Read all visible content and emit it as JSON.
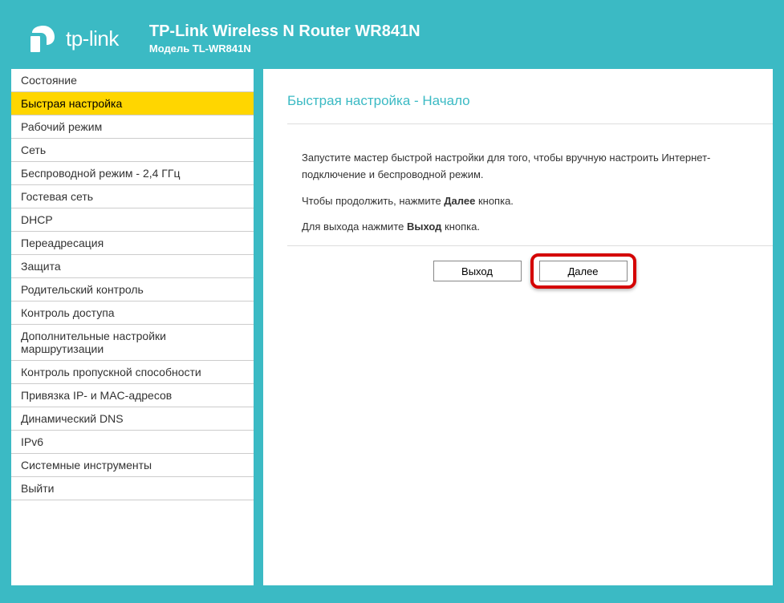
{
  "header": {
    "logo_text": "tp-link",
    "title": "TP-Link Wireless N Router WR841N",
    "subtitle": "Модель TL-WR841N"
  },
  "sidebar": {
    "items": [
      {
        "label": "Состояние",
        "active": false
      },
      {
        "label": "Быстрая настройка",
        "active": true
      },
      {
        "label": "Рабочий режим",
        "active": false
      },
      {
        "label": "Сеть",
        "active": false
      },
      {
        "label": "Беспроводной режим - 2,4 ГГц",
        "active": false
      },
      {
        "label": "Гостевая сеть",
        "active": false
      },
      {
        "label": "DHCP",
        "active": false
      },
      {
        "label": "Переадресация",
        "active": false
      },
      {
        "label": "Защита",
        "active": false
      },
      {
        "label": "Родительский контроль",
        "active": false
      },
      {
        "label": "Контроль доступа",
        "active": false
      },
      {
        "label": "Дополнительные настройки маршрутизации",
        "active": false
      },
      {
        "label": "Контроль пропускной способности",
        "active": false
      },
      {
        "label": "Привязка IP- и MAC-адресов",
        "active": false
      },
      {
        "label": "Динамический DNS",
        "active": false
      },
      {
        "label": "IPv6",
        "active": false
      },
      {
        "label": "Системные инструменты",
        "active": false
      },
      {
        "label": "Выйти",
        "active": false
      }
    ]
  },
  "main": {
    "page_title": "Быстрая настройка - Начало",
    "para1": "Запустите мастер быстрой настройки для того, чтобы вручную настроить Интернет-подключение и беспроводной режим.",
    "para2_a": "Чтобы продолжить, нажмите ",
    "para2_b": "Далее",
    "para2_c": " кнопка.",
    "para3_a": "Для выхода нажмите ",
    "para3_b": "Выход",
    "para3_c": " кнопка.",
    "exit_label": "Выход",
    "next_label": "Далее"
  }
}
